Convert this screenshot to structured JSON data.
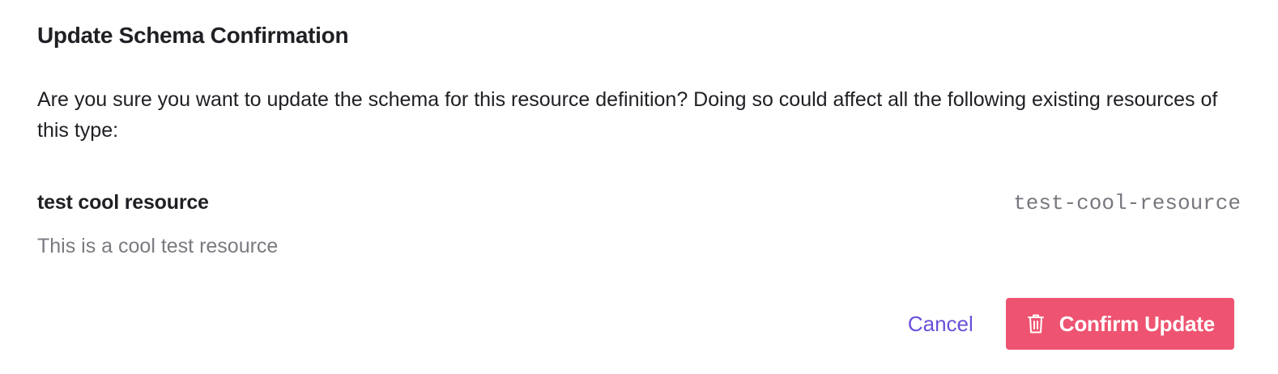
{
  "dialog": {
    "title": "Update Schema Confirmation",
    "message": "Are you sure you want to update the schema for this resource definition? Doing so could affect all the following existing resources of this type:"
  },
  "resources": [
    {
      "name": "test cool resource",
      "slug": "test-cool-resource",
      "description": "This is a cool test resource"
    }
  ],
  "footer": {
    "cancel_label": "Cancel",
    "confirm_label": "Confirm Update",
    "confirm_icon": "trash-icon"
  },
  "colors": {
    "accent": "#6b4fd8",
    "danger": "#ee5471",
    "text": "#1f1f24",
    "muted": "#7a7a80"
  }
}
